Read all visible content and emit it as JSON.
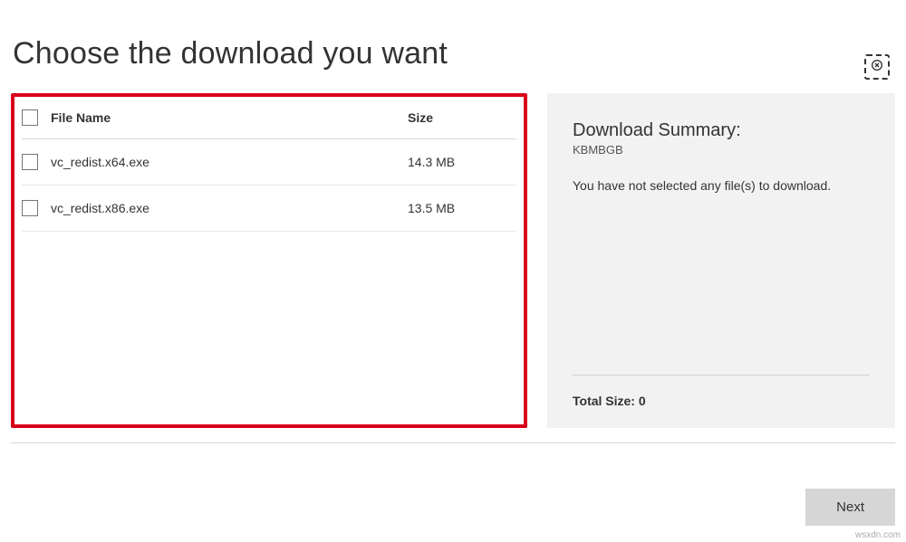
{
  "page_title": "Choose the download you want",
  "close_label": "Close",
  "table": {
    "header_name": "File Name",
    "header_size": "Size",
    "rows": [
      {
        "name": "vc_redist.x64.exe",
        "size": "14.3 MB"
      },
      {
        "name": "vc_redist.x86.exe",
        "size": "13.5 MB"
      }
    ]
  },
  "summary": {
    "title": "Download Summary:",
    "subtitle": "KBMBGB",
    "message": "You have not selected any file(s) to download.",
    "total_label": "Total Size: 0"
  },
  "next_label": "Next",
  "watermark": "wsxdn.com"
}
